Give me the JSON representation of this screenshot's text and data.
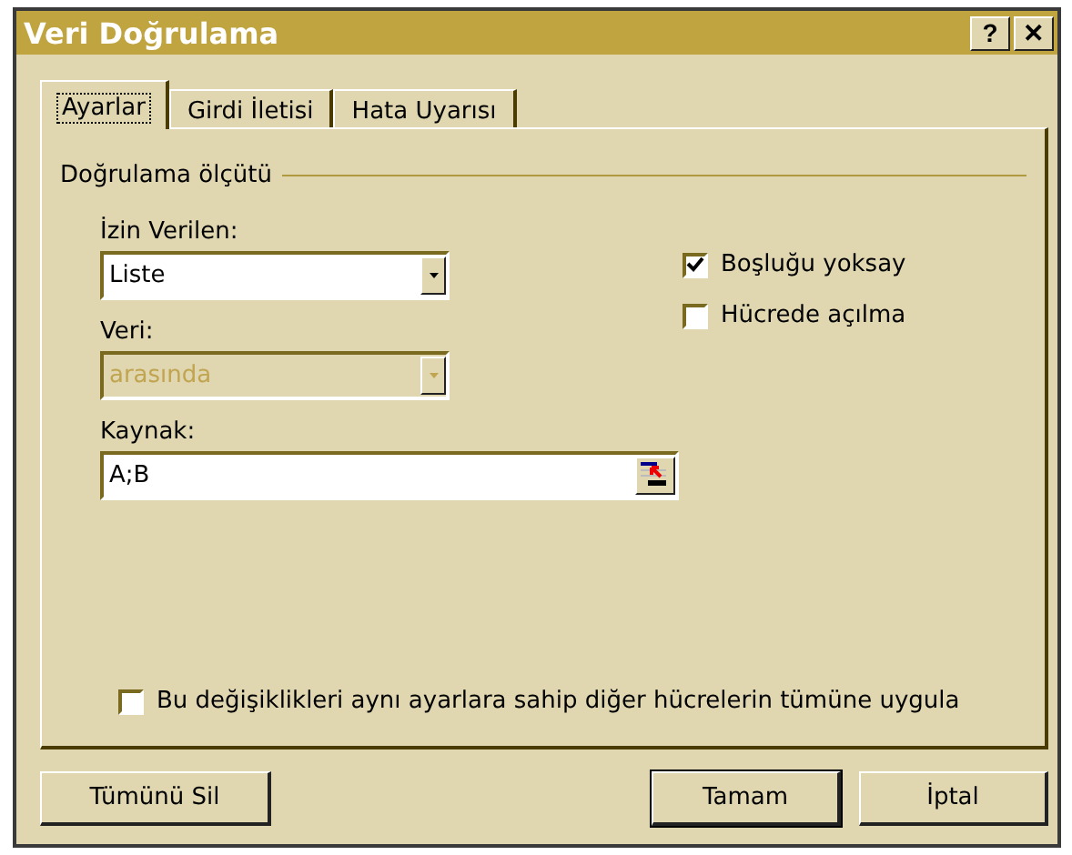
{
  "window": {
    "title": "Veri Doğrulama",
    "help": "?",
    "close": "✕"
  },
  "tabs": [
    {
      "label": "Ayarlar",
      "selected": true
    },
    {
      "label": "Girdi İletisi",
      "selected": false
    },
    {
      "label": "Hata Uyarısı",
      "selected": false
    }
  ],
  "group": {
    "title": "Doğrulama ölçütü"
  },
  "fields": [
    {
      "label": "İzin Verilen:",
      "value": "Liste",
      "kind": "combo",
      "disabled": false
    },
    {
      "label": "Veri:",
      "value": "arasında",
      "kind": "combo",
      "disabled": true
    },
    {
      "label": "Kaynak:",
      "value": "A;B",
      "kind": "ref",
      "disabled": false
    }
  ],
  "options": [
    {
      "label": "Boşluğu yoksay",
      "checked": true
    },
    {
      "label": "Hücrede açılma",
      "checked": false
    }
  ],
  "apply_all": {
    "label": "Bu değişiklikleri aynı ayarlara sahip diğer hücrelerin tümüne uygula",
    "checked": false
  },
  "buttons": [
    {
      "label": "Tümünü Sil",
      "default": false
    },
    {
      "label": "Tamam",
      "default": true
    },
    {
      "label": "İptal",
      "default": false
    }
  ]
}
